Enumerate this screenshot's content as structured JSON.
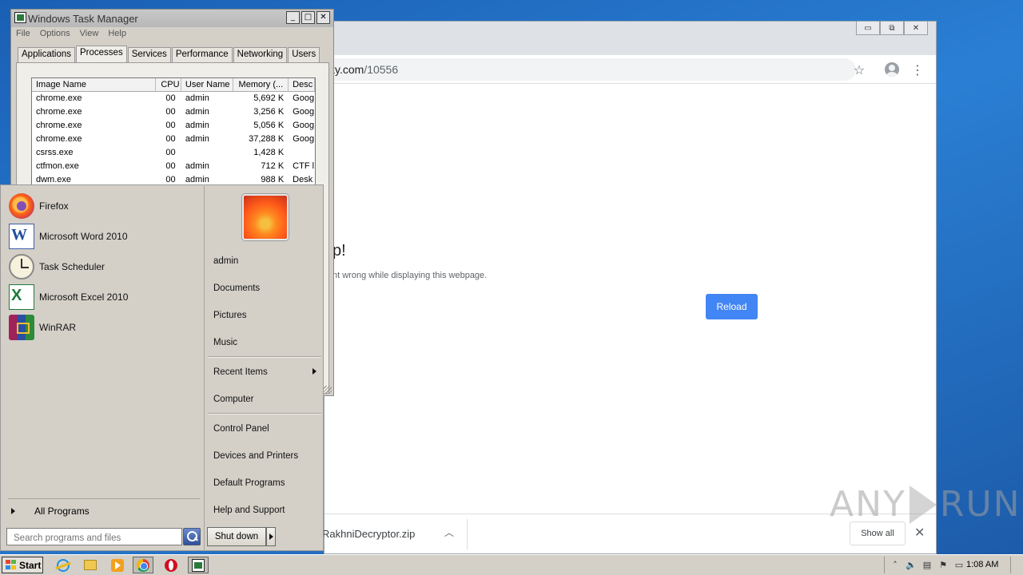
{
  "chrome": {
    "url_host": "ky.com",
    "url_path": "/10556",
    "error_title": "p!",
    "error_message": "nt wrong while displaying this webpage.",
    "reload_label": "Reload",
    "download_filename": "RakhniDecryptor.zip",
    "show_all_label": "Show all",
    "window_controls": [
      "minimize-icon",
      "restore-icon",
      "close-icon"
    ]
  },
  "watermark": {
    "left": "ANY",
    "right": "RUN"
  },
  "taskmgr": {
    "title": "Windows Task Manager",
    "menu": [
      "File",
      "Options",
      "View",
      "Help"
    ],
    "tabs": [
      "Applications",
      "Processes",
      "Services",
      "Performance",
      "Networking",
      "Users"
    ],
    "active_tab": "Processes",
    "columns": [
      "Image Name",
      "CPU",
      "User Name",
      "Memory (...",
      "Desc"
    ],
    "rows": [
      {
        "name": "chrome.exe",
        "cpu": "00",
        "user": "admin",
        "mem": "5,692 K",
        "desc": "Goog"
      },
      {
        "name": "chrome.exe",
        "cpu": "00",
        "user": "admin",
        "mem": "3,256 K",
        "desc": "Goog"
      },
      {
        "name": "chrome.exe",
        "cpu": "00",
        "user": "admin",
        "mem": "5,056 K",
        "desc": "Goog"
      },
      {
        "name": "chrome.exe",
        "cpu": "00",
        "user": "admin",
        "mem": "37,288 K",
        "desc": "Goog"
      },
      {
        "name": "csrss.exe",
        "cpu": "00",
        "user": "",
        "mem": "1,428 K",
        "desc": ""
      },
      {
        "name": "ctfmon.exe",
        "cpu": "00",
        "user": "admin",
        "mem": "712 K",
        "desc": "CTF l"
      },
      {
        "name": "dwm.exe",
        "cpu": "00",
        "user": "admin",
        "mem": "988 K",
        "desc": "Desk"
      }
    ]
  },
  "startmenu": {
    "programs": [
      {
        "label": "Firefox",
        "icon": "firefox-icon"
      },
      {
        "label": "Microsoft Word 2010",
        "icon": "word-icon"
      },
      {
        "label": "Task Scheduler",
        "icon": "task-scheduler-icon"
      },
      {
        "label": "Microsoft Excel 2010",
        "icon": "excel-icon"
      },
      {
        "label": "WinRAR",
        "icon": "winrar-icon"
      }
    ],
    "all_programs": "All Programs",
    "search_placeholder": "Search programs and files",
    "right_items": {
      "user": "admin",
      "documents": "Documents",
      "pictures": "Pictures",
      "music": "Music",
      "recent": "Recent Items",
      "computer": "Computer",
      "control_panel": "Control Panel",
      "devices": "Devices and Printers",
      "defaults": "Default Programs",
      "help": "Help and Support"
    },
    "shutdown_label": "Shut down"
  },
  "taskbar": {
    "start_label": "Start",
    "clock": "1:08 AM",
    "pinned": [
      "internet-explorer-icon",
      "explorer-folder-icon",
      "media-player-icon",
      "chrome-icon",
      "opera-icon",
      "task-manager-icon"
    ]
  }
}
